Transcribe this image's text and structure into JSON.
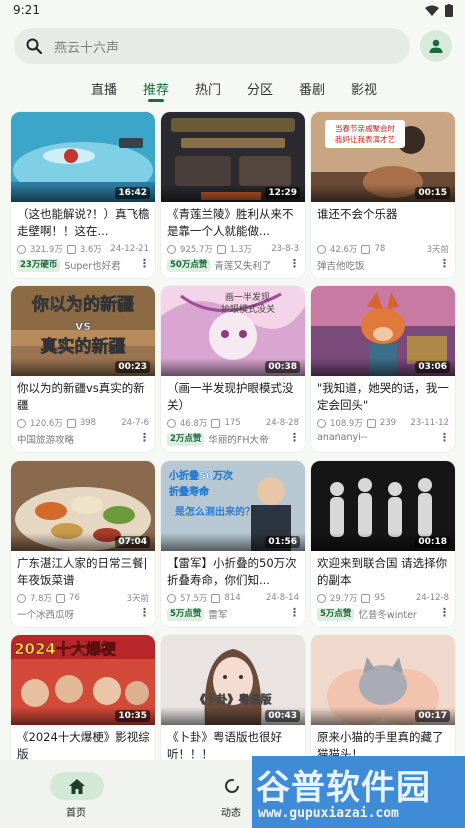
{
  "status_bar": {
    "time": "9:21"
  },
  "search": {
    "placeholder": "燕云十六声"
  },
  "tabs": [
    {
      "label": "直播"
    },
    {
      "label": "推荐",
      "active": true
    },
    {
      "label": "热门"
    },
    {
      "label": "分区"
    },
    {
      "label": "番剧"
    },
    {
      "label": "影视"
    }
  ],
  "videos": [
    {
      "duration": "16:42",
      "title": "（这也能解说?！）真飞檐走壁啊！！这在...",
      "views": "321.9万",
      "comments": "3.6万",
      "date": "24-12-21",
      "badge": "23万硬币",
      "author": "Super也好君"
    },
    {
      "duration": "12:29",
      "title": "《青莲兰陵》胜利从来不是靠一个人就能做...",
      "views": "925.7万",
      "comments": "1.3万",
      "date": "23-8-3",
      "badge": "50万点赞",
      "author": "青莲又失利了"
    },
    {
      "duration": "00:15",
      "title": "谁还不会个乐器",
      "views": "42.6万",
      "comments": "78",
      "date": "3天前",
      "badge": "",
      "author": "弹吉他吃饭"
    },
    {
      "duration": "00:23",
      "title": "你以为的新疆vs真实的新疆",
      "views": "120.6万",
      "comments": "398",
      "date": "24-7-6",
      "badge": "",
      "author": "中国旅游攻略"
    },
    {
      "duration": "00:38",
      "title": "（画一半发现护眼模式没关）",
      "views": "46.8万",
      "comments": "175",
      "date": "24-8-28",
      "badge": "2万点赞",
      "author": "华丽的FH大帝"
    },
    {
      "duration": "03:06",
      "title": "\"我知道，她哭的话，我一定会回头\"",
      "views": "108.9万",
      "comments": "239",
      "date": "23-11-12",
      "badge": "",
      "author": "anananyi--"
    },
    {
      "duration": "07:04",
      "title": "广东湛江人家的日常三餐|年夜饭菜谱",
      "views": "7.8万",
      "comments": "76",
      "date": "3天前",
      "badge": "",
      "author": "一个冰西瓜呀"
    },
    {
      "duration": "01:56",
      "title": "【雷军】小折叠的50万次折叠寿命，你们知...",
      "views": "57.5万",
      "comments": "814",
      "date": "24-8-14",
      "badge": "5万点赞",
      "author": "雷军"
    },
    {
      "duration": "00:18",
      "title": "欢迎来到联合国 请选择你的副本",
      "views": "29.7万",
      "comments": "95",
      "date": "24-12-8",
      "badge": "5万点赞",
      "author": "忆昔冬winter"
    },
    {
      "duration": "10:35",
      "title": "《2024十大爆梗》影视综版",
      "views": "",
      "comments": "",
      "date": "",
      "badge": "",
      "author": ""
    },
    {
      "duration": "00:43",
      "title": "《卜卦》粤语版也很好听！！！",
      "views": "",
      "comments": "",
      "date": "",
      "badge": "",
      "author": ""
    },
    {
      "duration": "00:17",
      "title": "原来小猫的手里真的藏了猫猫头！",
      "views": "",
      "comments": "",
      "date": "",
      "badge": "",
      "author": ""
    }
  ],
  "thumb_text": {
    "v3": "当春节亲戚聚会时\n我妈让我表演才艺",
    "v4_a": "你以为的新疆",
    "v4_b": "vs",
    "v4_c": "真实的新疆",
    "v5": "画一半发现护眼模式没关",
    "v8_a": "小折叠50万次",
    "v8_b": "折叠寿命",
    "v8_c": "是怎么测出来的？",
    "v10": "2024十大爆梗",
    "v11": "《卜卦》粤语版"
  },
  "bottom_nav": [
    {
      "label": "首页",
      "icon": "home-icon",
      "active": true
    },
    {
      "label": "动态",
      "icon": "dynamic-icon"
    }
  ],
  "watermark": {
    "main": "谷普软件园",
    "url": "www.gupuxiazai.com"
  },
  "colors": {
    "accent": "#176b3c",
    "badge_bg": "#dcefe1",
    "background": "#f6f8f4"
  }
}
